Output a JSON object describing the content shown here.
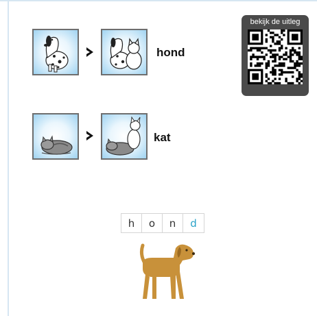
{
  "rows": [
    {
      "word": "hond",
      "left_icon": "dalmatian-dog-icon",
      "right_icon": "dalmatian-with-cat-icon"
    },
    {
      "word": "kat",
      "left_icon": "sleeping-cat-icon",
      "right_icon": "sleeping-cat-with-white-cat-icon"
    }
  ],
  "qr": {
    "label": "bekijk de uitleg",
    "icon": "qr-code-icon"
  },
  "letters": [
    {
      "char": "h",
      "color": "#333333"
    },
    {
      "char": "o",
      "color": "#333333"
    },
    {
      "char": "n",
      "color": "#333333"
    },
    {
      "char": "d",
      "color": "#2aa3c8"
    }
  ],
  "picture": {
    "icon": "brown-dog-icon",
    "color": "#c8913a"
  }
}
